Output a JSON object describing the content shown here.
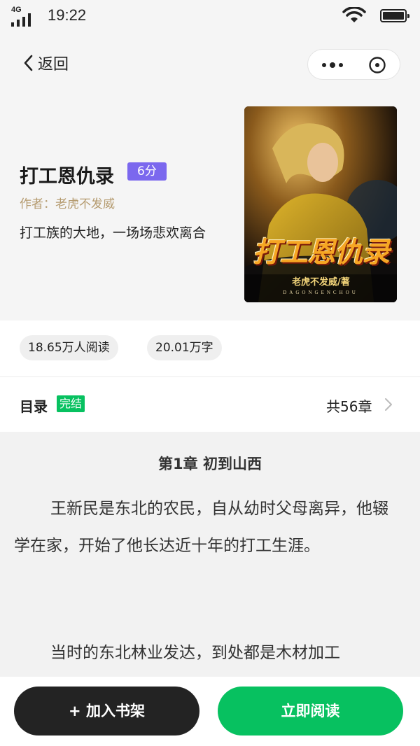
{
  "status_bar": {
    "network": "4G",
    "time": "19:22"
  },
  "nav": {
    "back_label": "返回"
  },
  "book": {
    "title": "打工恩仇录",
    "score": "6分",
    "author_line": "作者：老虎不发威",
    "intro": "打工族的大地，一场场悲欢离合",
    "cover": {
      "title": "打工恩仇录",
      "author": "老虎不发威/著",
      "pinyin": "DAGONGENCHOU"
    }
  },
  "stats": {
    "readers": "18.65万人阅读",
    "words": "20.01万字"
  },
  "toc": {
    "label": "目录",
    "status": "完结",
    "chapter_count": "共56章"
  },
  "reader": {
    "chapter_title": "第1章  初到山西",
    "paragraphs": [
      "王新民是东北的农民，自从幼时父母离异，他辍学在家，开始了他长达近十年的打工生涯。",
      "当时的东北林业发达，到处都是木材加工"
    ]
  },
  "actions": {
    "add_shelf": "+ 加入书架",
    "read_now": "立即阅读"
  },
  "colors": {
    "score_badge": "#7b68ee",
    "complete_badge": "#07c160",
    "read_button": "#07c160",
    "shelf_button": "#232323",
    "author": "#b59b6f"
  }
}
